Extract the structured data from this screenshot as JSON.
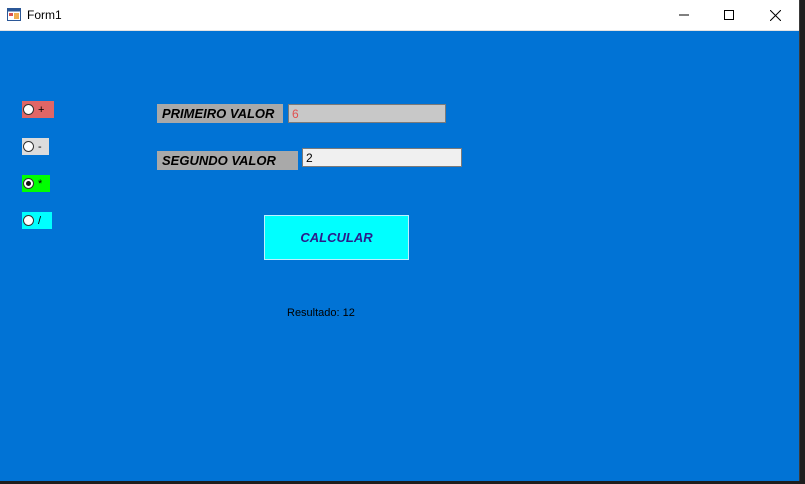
{
  "window": {
    "title": "Form1",
    "background_color": "#0173d5"
  },
  "titlebar_buttons": {
    "minimize": "minimize-icon",
    "maximize": "maximize-icon",
    "close": "close-icon"
  },
  "operations": [
    {
      "label": "+",
      "color": "#e06666",
      "checked": false
    },
    {
      "label": "-",
      "color": "#dcdcdc",
      "checked": false
    },
    {
      "label": "*",
      "color": "#00ff00",
      "checked": true
    },
    {
      "label": "/",
      "color": "#00ffff",
      "checked": false
    }
  ],
  "form": {
    "primeiro_label": "PRIMEIRO VALOR",
    "primeiro_value": "6",
    "segundo_label": "SEGUNDO VALOR",
    "segundo_value": "2",
    "calcular_label": "CALCULAR",
    "resultado": "Resultado: 12"
  }
}
